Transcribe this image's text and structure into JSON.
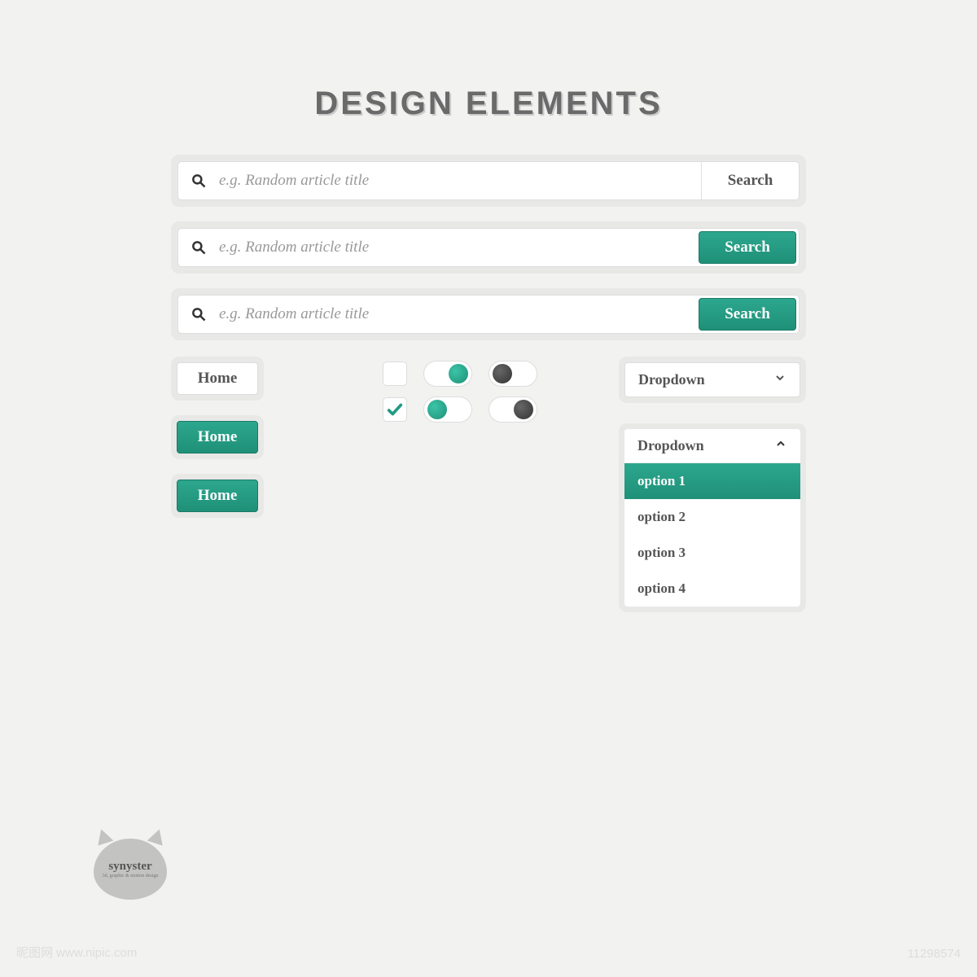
{
  "title": "DESIGN ELEMENTS",
  "search": {
    "placeholder": "e.g. Random article title",
    "button_label": "Search"
  },
  "buttons": {
    "home": "Home"
  },
  "checkboxes": {
    "unchecked": false,
    "checked": true
  },
  "toggles": {
    "t1": "on-teal",
    "t2": "off-dark",
    "t3": "on-teal",
    "t4": "off-dark"
  },
  "dropdown": {
    "label": "Dropdown",
    "options": [
      "option 1",
      "option 2",
      "option 3",
      "option 4"
    ],
    "selected_index": 0
  },
  "brand": {
    "name": "synyster",
    "tagline": "3d, graphic & motion design"
  },
  "colors": {
    "teal": "#229a81",
    "bg": "#f2f2f1"
  },
  "watermark": {
    "left": "昵图网 www.nipic.com",
    "right": "11298574"
  }
}
